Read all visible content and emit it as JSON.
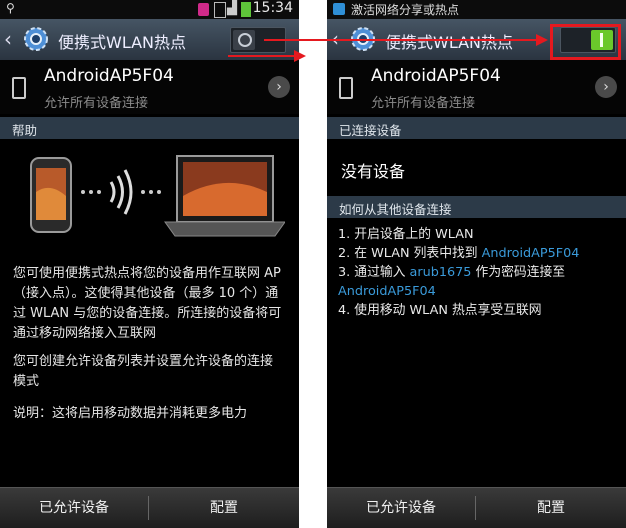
{
  "left": {
    "status_time": "15:34",
    "title": "便携式WLAN热点",
    "network": {
      "name": "AndroidAP5F04",
      "subtitle": "允许所有设备连接"
    },
    "help_header": "帮助",
    "help_paragraphs": [
      "您可使用便携式热点将您的设备用作互联网 AP（接入点）。这使得其他设备（最多 10 个）通过 WLAN 与您的设备连接。所连接的设备将可通过移动网络接入互联网",
      "您可创建允许设备列表并设置允许设备的连接模式",
      "说明：这将启用移动数据并消耗更多电力"
    ],
    "bottom": {
      "allowed_devices": "已允许设备",
      "config": "配置"
    },
    "toggle_state": "off"
  },
  "right": {
    "notification": "激活网络分享或热点",
    "title": "便携式WLAN热点",
    "network": {
      "name": "AndroidAP5F04",
      "subtitle": "允许所有设备连接"
    },
    "connected_header": "已连接设备",
    "no_devices": "没有设备",
    "howto_header": "如何从其他设备连接",
    "steps": {
      "s1": "1. 开启设备上的 WLAN",
      "s2_prefix": "2. 在 WLAN 列表中找到 ",
      "s2_link": "AndroidAP5F04",
      "s3_prefix": "3. 通过输入 ",
      "s3_password": "arub1675",
      "s3_suffix": " 作为密码连接至",
      "s3_link": "AndroidAP5F04",
      "s4": "4. 使用移动 WLAN 热点享受互联网"
    },
    "bottom": {
      "allowed_devices": "已允许设备",
      "config": "配置"
    },
    "toggle_state": "on"
  },
  "colors": {
    "accent_link": "#3a9ad9",
    "toggle_on": "#6ac82b",
    "highlight": "#e5191f"
  }
}
